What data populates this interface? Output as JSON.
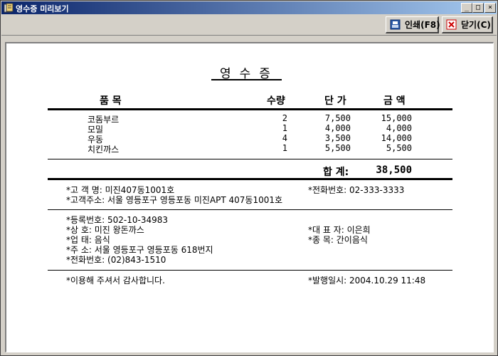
{
  "window": {
    "title": "영수증 미리보기"
  },
  "titlebar_buttons": {
    "minimize": "_",
    "maximize": "□",
    "close": "×"
  },
  "toolbar": {
    "print_label": "인쇄(F8)",
    "close_label": "닫기(C)"
  },
  "receipt": {
    "title": "영수증",
    "headers": {
      "item": "품        목",
      "qty": "수량",
      "unit_price": "단 가",
      "amount": "금 액"
    },
    "items": [
      {
        "name": "코돔부르",
        "qty": "2",
        "unit_price": "7,500",
        "amount": "15,000"
      },
      {
        "name": "모밀",
        "qty": "1",
        "unit_price": "4,000",
        "amount": "4,000"
      },
      {
        "name": "우동",
        "qty": "4",
        "unit_price": "3,500",
        "amount": "14,000"
      },
      {
        "name": "치킨까스",
        "qty": "1",
        "unit_price": "5,500",
        "amount": "5,500"
      }
    ],
    "total_label": "합 계:",
    "total_value": "38,500",
    "customer_name": "*고 객 명: 미진407동1001호",
    "customer_address": "*고객주소: 서울 영등포구 영등포동 미진APT 407동1001호",
    "customer_phone": "*전화번호: 02-333-3333",
    "reg_no": "*등록번호: 502-10-34983",
    "business_name": "*상    호: 미진 왕돈까스",
    "business_type": "*업    태: 음식",
    "business_address": "*주    소: 서울 영등포구 영등포동 618번지",
    "business_phone": "*전화번호: (02)843-1510",
    "representative": "*대 표 자: 이은희",
    "category": "*종    목: 간이음식",
    "thanks": "*이용해 주셔서 감사합니다.",
    "issued_at": "*발행일시: 2004.10.29 11:48"
  },
  "colors": {
    "title_start": "#0a246a",
    "title_end": "#a6caf0",
    "chrome": "#d4d0c8",
    "close_icon": "#cc0000",
    "print_icon": "#2a5aa8"
  }
}
